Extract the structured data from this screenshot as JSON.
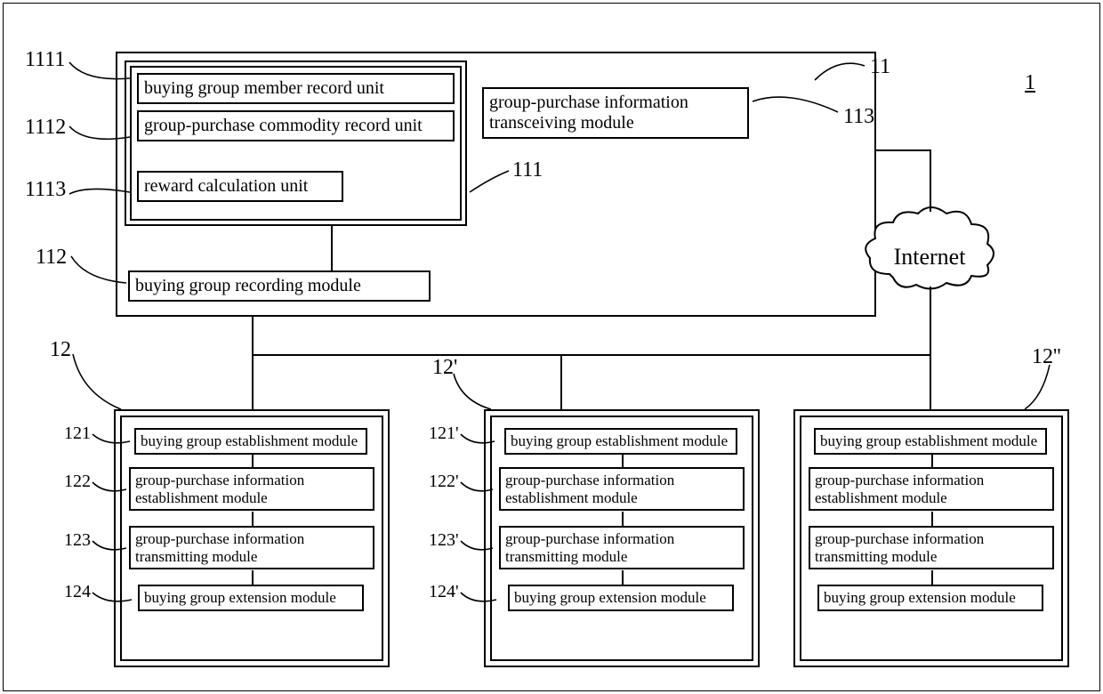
{
  "figure_label": "1",
  "internet_label": "Internet",
  "server": {
    "ref": "11",
    "transceiving": {
      "ref": "113",
      "label": "group-purchase information transceiving module"
    },
    "record_group": {
      "ref": "111",
      "member_unit": {
        "ref": "1111",
        "label": "buying group member record unit"
      },
      "commodity_unit": {
        "ref": "1112",
        "label": "group-purchase commodity record unit"
      },
      "reward_unit": {
        "ref": "1113",
        "label": "reward calculation unit"
      }
    },
    "recording_module": {
      "ref": "112",
      "label": "buying group recording module"
    }
  },
  "clients": [
    {
      "ref": "12",
      "m1": {
        "ref": "121",
        "label": "buying group establishment module"
      },
      "m2": {
        "ref": "122",
        "label": "group-purchase information establishment module"
      },
      "m3": {
        "ref": "123",
        "label": "group-purchase information transmitting module"
      },
      "m4": {
        "ref": "124",
        "label": "buying group extension module"
      }
    },
    {
      "ref": "12'",
      "m1": {
        "ref": "121'",
        "label": "buying group establishment module"
      },
      "m2": {
        "ref": "122'",
        "label": "group-purchase information establishment module"
      },
      "m3": {
        "ref": "123'",
        "label": "group-purchase information transmitting module"
      },
      "m4": {
        "ref": "124'",
        "label": "buying group extension module"
      }
    },
    {
      "ref": "12''",
      "m1": {
        "ref": "",
        "label": "buying group establishment module"
      },
      "m2": {
        "ref": "",
        "label": "group-purchase information establishment module"
      },
      "m3": {
        "ref": "",
        "label": "group-purchase information transmitting module"
      },
      "m4": {
        "ref": "",
        "label": "buying group extension module"
      }
    }
  ]
}
